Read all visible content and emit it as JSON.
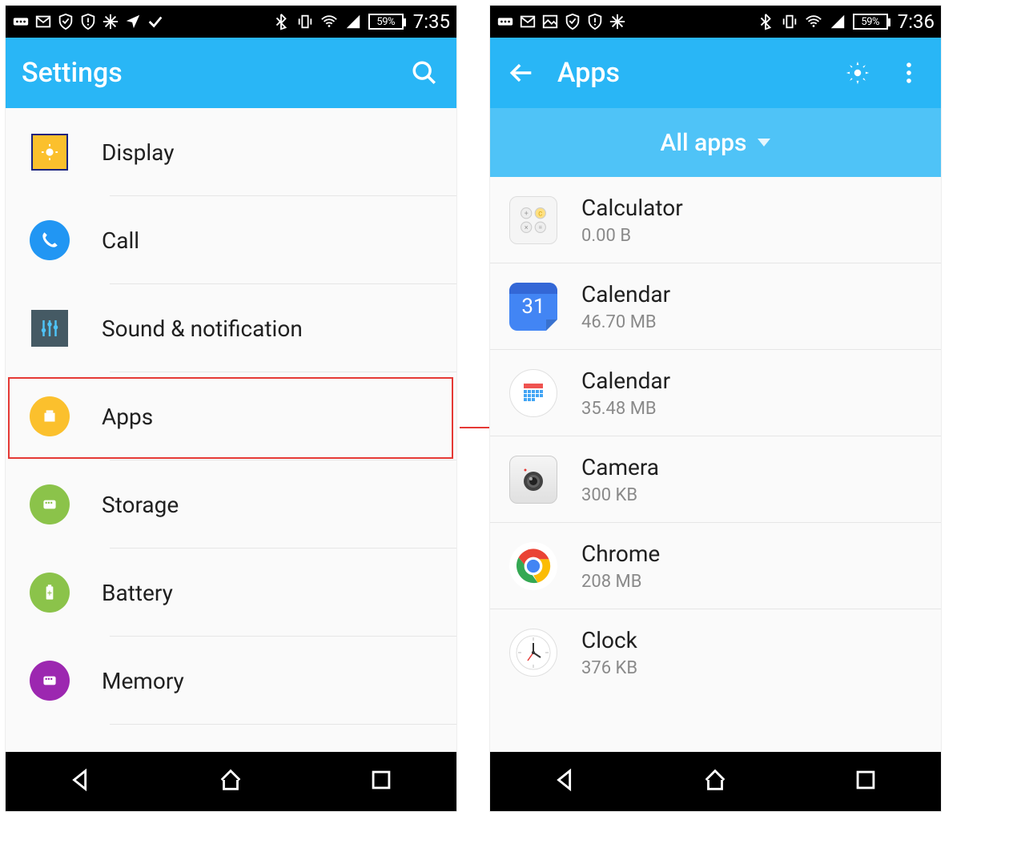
{
  "left": {
    "status": {
      "battery": "59%",
      "time": "7:35"
    },
    "appbar": {
      "title": "Settings"
    },
    "items": [
      {
        "label": "Display"
      },
      {
        "label": "Call"
      },
      {
        "label": "Sound & notification"
      },
      {
        "label": "Apps"
      },
      {
        "label": "Storage"
      },
      {
        "label": "Battery"
      },
      {
        "label": "Memory"
      }
    ]
  },
  "right": {
    "status": {
      "battery": "59%",
      "time": "7:36"
    },
    "appbar": {
      "title": "Apps"
    },
    "subbar": {
      "label": "All apps"
    },
    "apps": [
      {
        "name": "Calculator",
        "size": "0.00 B"
      },
      {
        "name": "Calendar",
        "size": "46.70 MB"
      },
      {
        "name": "Calendar",
        "size": "35.48 MB"
      },
      {
        "name": "Camera",
        "size": "300 KB"
      },
      {
        "name": "Chrome",
        "size": "208 MB"
      },
      {
        "name": "Clock",
        "size": "376 KB"
      }
    ]
  }
}
